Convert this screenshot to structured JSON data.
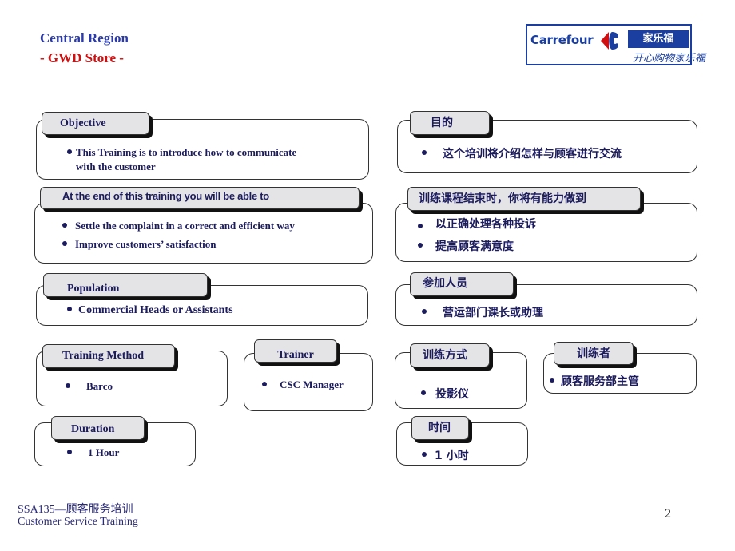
{
  "header": {
    "title_line1": "Central  Region",
    "title_line2": "- GWD Store -",
    "logo": {
      "brand": "Carrefour",
      "chinese_name": "家乐福",
      "slogan": "开心购物家乐福"
    }
  },
  "english": {
    "objective": {
      "label": "Objective",
      "items": [
        "This Training  is to introduce how to communicate",
        "with  the customer"
      ]
    },
    "outcomes": {
      "label": "At the end of this training you will be able to",
      "items": [
        "Settle the complaint  in  a correct and  efficient  way",
        "Improve customers’ satisfaction"
      ]
    },
    "population": {
      "label": "Population",
      "items": [
        "Commercial  Heads or Assistants"
      ]
    },
    "method": {
      "label": "Training  Method",
      "items": [
        "Barco"
      ]
    },
    "trainer": {
      "label": "Trainer",
      "items": [
        "CSC Manager"
      ]
    },
    "duration": {
      "label": "Duration",
      "items": [
        "1 Hour"
      ]
    }
  },
  "chinese": {
    "objective": {
      "label": "目的",
      "items": [
        "这个培训将介绍怎样与顾客进行交流"
      ]
    },
    "outcomes": {
      "label": "训练课程结束时，你将有能力做到",
      "items": [
        "以正确处理各种投诉",
        "提高顾客满意度"
      ]
    },
    "population": {
      "label": "参加人员",
      "items": [
        "营运部门课长或助理"
      ]
    },
    "method": {
      "label": "训练方式",
      "items": [
        "投影仪"
      ]
    },
    "trainer": {
      "label": "训练者",
      "items": [
        "顾客服务部主管"
      ]
    },
    "duration": {
      "label": "时间",
      "items": [
        "1  小时"
      ]
    }
  },
  "footer": {
    "line1": "SSA135—顾客服务培训",
    "line2": "Customer  Service  Training",
    "page_number": "2"
  }
}
